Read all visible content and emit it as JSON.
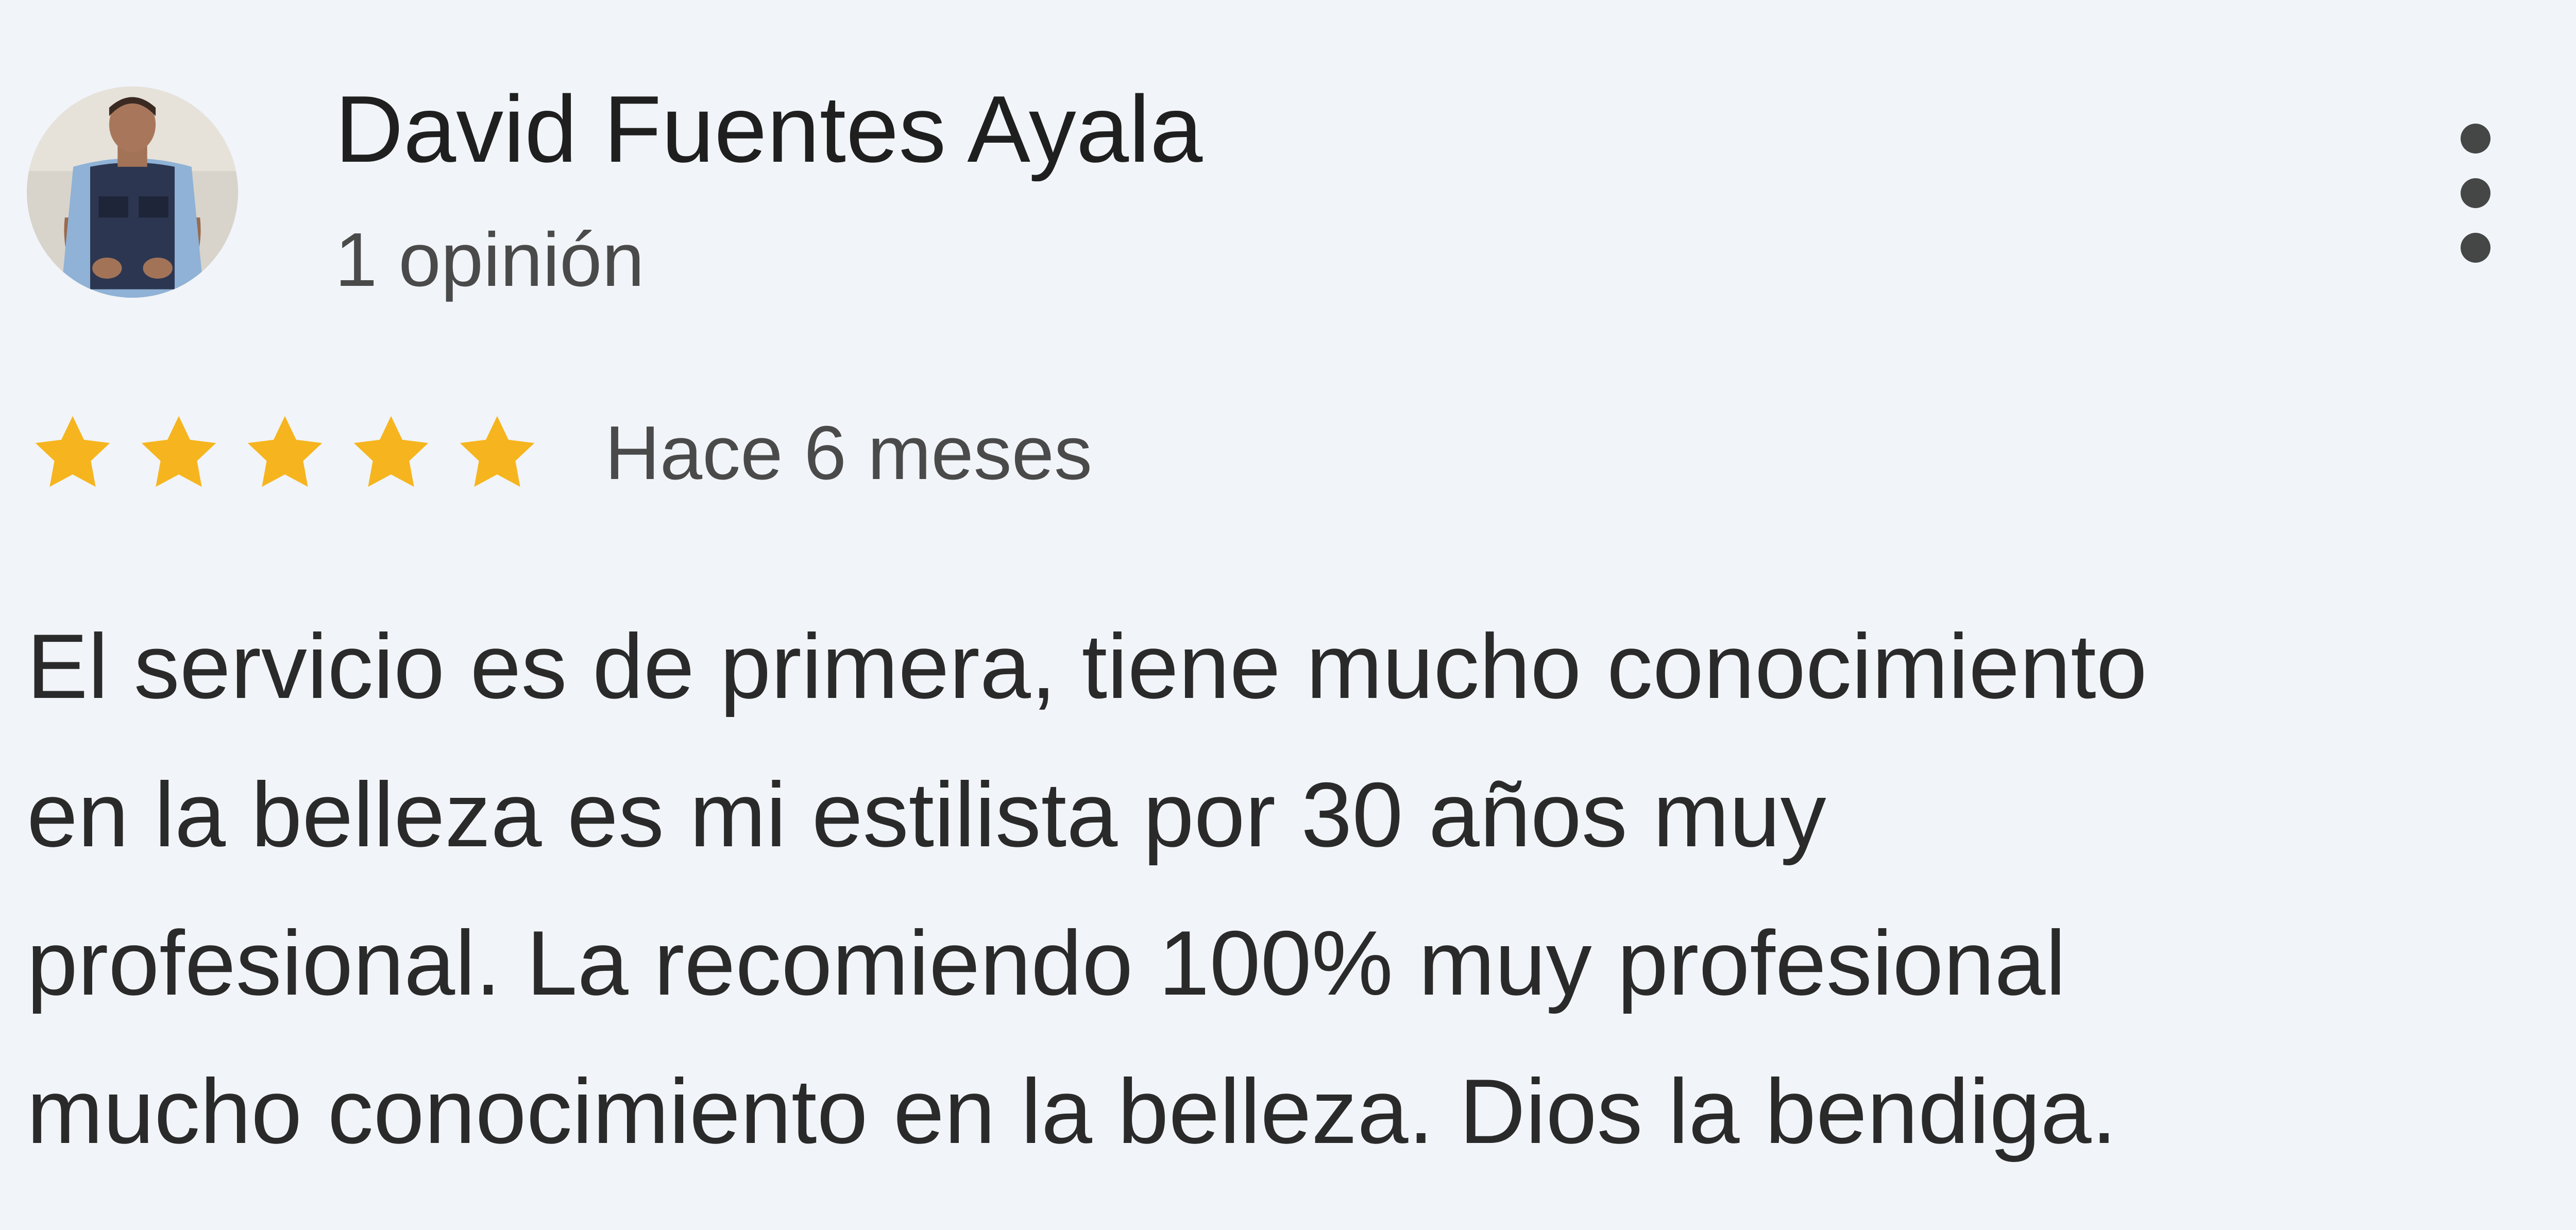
{
  "review": {
    "author_name": "David Fuentes Ayala",
    "author_meta": "1 opinión",
    "rating": 5,
    "rating_max": 5,
    "date": "Hace 6 meses",
    "text": "El servicio es de primera, tiene mucho conocimiento\nen la belleza es mi estilista por 30 años muy\nprofesional. La recomiendo 100% muy profesional\nmucho conocimiento en la belleza. Dios la bendiga."
  },
  "icons": {
    "more": "more-vert-icon",
    "star": "star-icon",
    "avatar": "avatar-photo"
  },
  "colors": {
    "background": "#f1f4f8",
    "star": "#f6b51e",
    "text_primary": "#1f1f1f",
    "text_secondary": "#4a4a4a"
  }
}
